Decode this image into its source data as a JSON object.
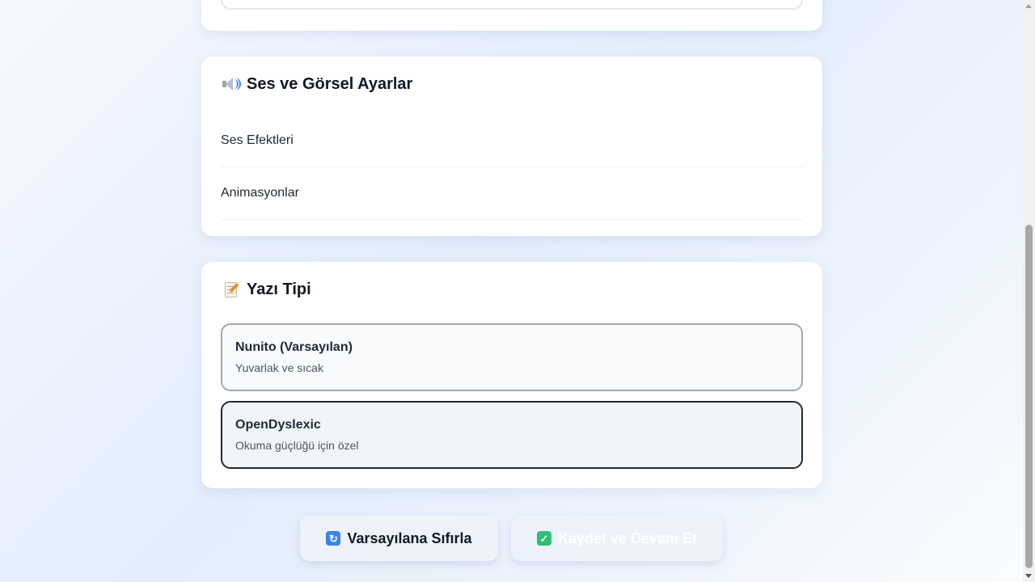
{
  "sound_visual": {
    "icon": "speaker-icon",
    "title": "Ses ve Görsel Ayarlar",
    "rows": [
      {
        "label": "Ses Efektleri"
      },
      {
        "label": "Animasyonlar"
      }
    ]
  },
  "font": {
    "icon": "memo-icon",
    "title": "Yazı Tipi",
    "options": [
      {
        "name": "Nunito (Varsayılan)",
        "description": "Yuvarlak ve sıcak"
      },
      {
        "name": "OpenDyslexic",
        "description": "Okuma güçlüğü için özel",
        "selected": true
      }
    ]
  },
  "actions": {
    "reset_label": "Varsayılana Sıfırla",
    "reset_icon": "reset-icon",
    "save_label": "Kaydet ve Devam Et",
    "save_icon": "check-icon"
  },
  "colors": {
    "accent_blue": "#3b82f6",
    "check_green": "#2fbf71",
    "selected_border": "#1f2937"
  }
}
